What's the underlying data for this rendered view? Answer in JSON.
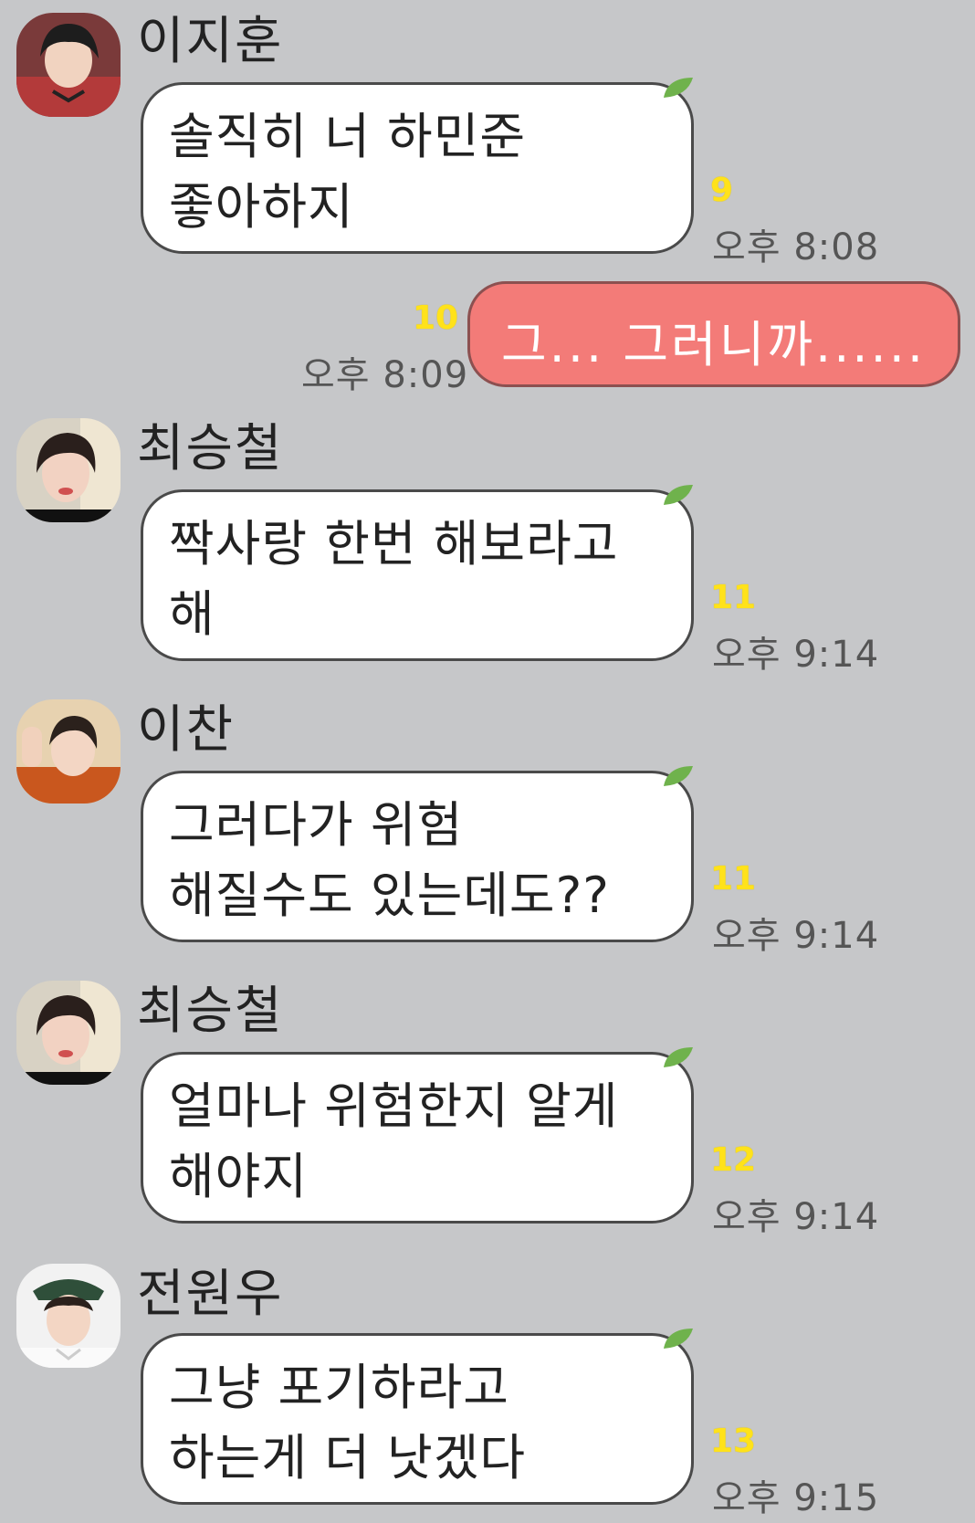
{
  "messages": [
    {
      "sender": "이지훈",
      "lines": [
        "솔직히 너 하민준",
        "좋아하지"
      ],
      "read_count": "9",
      "time": "오후 8:08"
    },
    {
      "sender": "",
      "lines": [
        "그... 그러니까......"
      ],
      "read_count": "10",
      "time": "오후 8:09",
      "mine": true
    },
    {
      "sender": "최승철",
      "lines": [
        "짝사랑 한번 해보라고",
        "해"
      ],
      "read_count": "11",
      "time": "오후 9:14"
    },
    {
      "sender": "이찬",
      "lines": [
        "그러다가 위험",
        "해질수도 있는데도??"
      ],
      "read_count": "11",
      "time": "오후 9:14"
    },
    {
      "sender": "최승철",
      "lines": [
        "얼마나 위험한지 알게",
        "해야지"
      ],
      "read_count": "12",
      "time": "오후 9:14"
    },
    {
      "sender": "전원우",
      "lines": [
        "그냥 포기하라고",
        "하는게 더 낫겠다"
      ],
      "read_count": "13",
      "time": "오후 9:15"
    }
  ],
  "colors": {
    "background": "#c6c7c9",
    "incoming_bubble": "#ffffff",
    "outgoing_bubble": "#f37b78",
    "read_count": "#ffe21a",
    "leaf": "#6fb24c"
  }
}
